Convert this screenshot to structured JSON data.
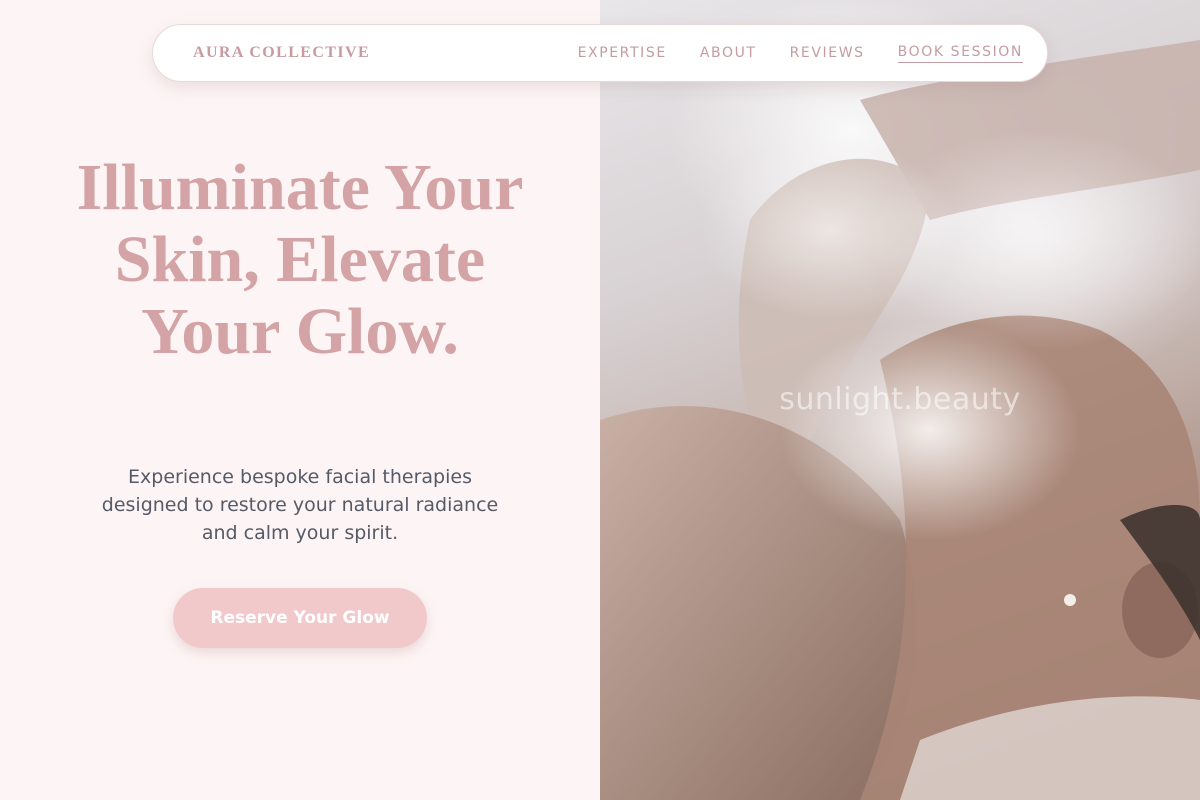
{
  "header": {
    "brand": "AURA COLLECTIVE",
    "nav": {
      "expertise": "EXPERTISE",
      "about": "ABOUT",
      "reviews": "REVIEWS",
      "book": "BOOK SESSION"
    }
  },
  "hero": {
    "title": "Illuminate Your Skin, Elevate Your Glow.",
    "subtitle": "Experience bespoke facial therapies designed to restore your natural radiance and calm your spirit.",
    "cta_label": "Reserve Your Glow"
  },
  "photo": {
    "watermark": "sunlight.beauty"
  },
  "colors": {
    "accent_pink": "#d4a3a5",
    "button_pink": "#f2c9cb",
    "nav_text": "#c59ca1",
    "panel_background": "#fdf5f5",
    "body_text": "#555a66"
  }
}
